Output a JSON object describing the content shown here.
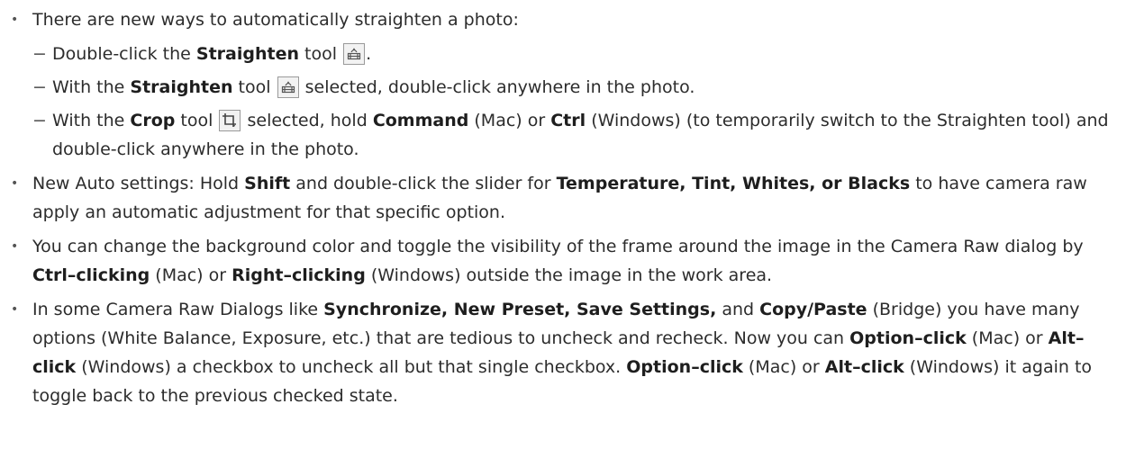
{
  "straighten": {
    "intro": "There are new ways to automatically straighten a photo:",
    "items": [
      {
        "p1": "Double-click the ",
        "b1": "Straighten",
        "p2": " tool ",
        "icon": "straighten-tool-icon",
        "p3": "."
      },
      {
        "p1": "With the ",
        "b1": "Straighten",
        "p2": " tool ",
        "icon": "straighten-tool-icon",
        "p3": " selected, double-click anywhere in the photo."
      },
      {
        "p1": "With the ",
        "b1": "Crop",
        "p2": " tool ",
        "icon": "crop-tool-icon",
        "p3": " selected, hold ",
        "b2": "Command",
        "p4": " (Mac) or ",
        "b3": "Ctrl",
        "p5": " (Windows) (to temporarily switch to the Straighten tool) and double-click anywhere in the photo."
      }
    ]
  },
  "auto_settings": {
    "p1": "New Auto settings: Hold ",
    "b1": "Shift",
    "p2": " and double-click the slider for ",
    "b2": "Temperature, Tint, Whites, or Blacks",
    "p3": " to have camera raw apply an automatic adjustment for that specific option."
  },
  "background": {
    "p1": "You can change the background color and toggle the visibility of the frame around the image in the Camera Raw dialog by ",
    "b1": "Ctrl–clicking",
    "p2": " (Mac) or ",
    "b2": "Right–clicking",
    "p3": " (Windows) outside the image in the work area."
  },
  "dialogs": {
    "p1": "In some Camera Raw Dialogs like ",
    "b1": "Synchronize, New Preset, Save Settings,",
    "p2": " and ",
    "b2": "Copy/Paste",
    "p3": " (Bridge) you have many options (White Balance, Exposure, etc.) that are tedious to uncheck and recheck. Now you can ",
    "b3": "Option–click",
    "p4": " (Mac) or ",
    "b4": "Alt–click",
    "p5": " (Windows) a checkbox to uncheck all but that single checkbox. ",
    "b5": "Option–click",
    "p6": " (Mac) or ",
    "b6": "Alt–click",
    "p7": " (Windows) it again to toggle back to the previous checked state."
  }
}
